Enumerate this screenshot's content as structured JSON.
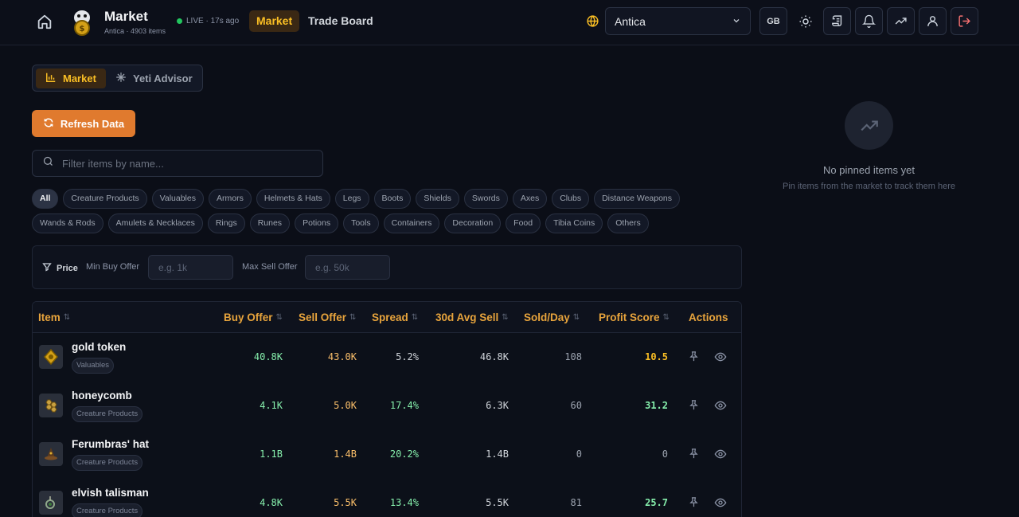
{
  "header": {
    "title": "Market",
    "subtitle": "Antica · 4903 items",
    "live_text": "LIVE · 17s ago",
    "nav": [
      {
        "label": "Market",
        "active": true
      },
      {
        "label": "Trade Board",
        "active": false
      }
    ],
    "world": "Antica",
    "region_btn": "GB",
    "icons": [
      "home-icon",
      "globe-icon",
      "sun-icon",
      "scroll-icon",
      "bell-icon",
      "trending-icon",
      "user-icon",
      "logout-icon"
    ]
  },
  "view_toggle": {
    "market_label": "Market",
    "yeti_label": "Yeti Advisor"
  },
  "refresh_label": "Refresh Data",
  "search": {
    "placeholder": "Filter items by name..."
  },
  "categories": {
    "row1": [
      "All",
      "Creature Products",
      "Valuables",
      "Armors",
      "Helmets & Hats",
      "Legs",
      "Boots",
      "Shields",
      "Swords",
      "Axes",
      "Clubs",
      "Distance Weapons"
    ],
    "row2": [
      "Wands & Rods",
      "Amulets & Necklaces",
      "Rings",
      "Runes",
      "Potions",
      "Tools",
      "Containers",
      "Decoration",
      "Food",
      "Tibia Coins",
      "Others"
    ],
    "active": "All"
  },
  "price_filter": {
    "label": "Price",
    "min_label": "Min Buy Offer",
    "min_placeholder": "e.g. 1k",
    "max_label": "Max Sell Offer",
    "max_placeholder": "e.g. 50k"
  },
  "table": {
    "headers": {
      "item": "Item",
      "buy": "Buy Offer",
      "sell": "Sell Offer",
      "spread": "Spread",
      "avg": "30d Avg Sell",
      "sold": "Sold/Day",
      "score": "Profit Score",
      "actions": "Actions"
    },
    "rows": [
      {
        "name": "gold token",
        "category": "Valuables",
        "buy": "40.8K",
        "sell": "43.0K",
        "spread": "5.2%",
        "avg": "46.8K",
        "sold": "108",
        "score": "10.5"
      },
      {
        "name": "honeycomb",
        "category": "Creature Products",
        "buy": "4.1K",
        "sell": "5.0K",
        "spread": "17.4%",
        "avg": "6.3K",
        "sold": "60",
        "score": "31.2"
      },
      {
        "name": "Ferumbras' hat",
        "category": "Creature Products",
        "buy": "1.1B",
        "sell": "1.4B",
        "spread": "20.2%",
        "avg": "1.4B",
        "sold": "0",
        "score": "0"
      },
      {
        "name": "elvish talisman",
        "category": "Creature Products",
        "buy": "4.8K",
        "sell": "5.5K",
        "spread": "13.4%",
        "avg": "5.5K",
        "sold": "81",
        "score": "25.7"
      }
    ]
  },
  "pinned": {
    "title": "No pinned items yet",
    "subtitle": "Pin items from the market to track them here"
  },
  "colors": {
    "accent": "#fbbf24",
    "refresh": "#e07a2e",
    "positive": "#86efac",
    "sell": "#fbbf6a",
    "background": "#0b0e17"
  }
}
